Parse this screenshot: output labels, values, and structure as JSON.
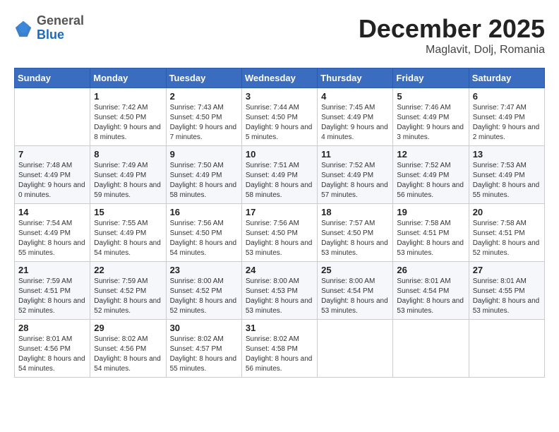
{
  "logo": {
    "general": "General",
    "blue": "Blue"
  },
  "header": {
    "month": "December 2025",
    "location": "Maglavit, Dolj, Romania"
  },
  "weekdays": [
    "Sunday",
    "Monday",
    "Tuesday",
    "Wednesday",
    "Thursday",
    "Friday",
    "Saturday"
  ],
  "weeks": [
    [
      {
        "day": "",
        "sunrise": "",
        "sunset": "",
        "daylight": ""
      },
      {
        "day": "1",
        "sunrise": "Sunrise: 7:42 AM",
        "sunset": "Sunset: 4:50 PM",
        "daylight": "Daylight: 9 hours and 8 minutes."
      },
      {
        "day": "2",
        "sunrise": "Sunrise: 7:43 AM",
        "sunset": "Sunset: 4:50 PM",
        "daylight": "Daylight: 9 hours and 7 minutes."
      },
      {
        "day": "3",
        "sunrise": "Sunrise: 7:44 AM",
        "sunset": "Sunset: 4:50 PM",
        "daylight": "Daylight: 9 hours and 5 minutes."
      },
      {
        "day": "4",
        "sunrise": "Sunrise: 7:45 AM",
        "sunset": "Sunset: 4:49 PM",
        "daylight": "Daylight: 9 hours and 4 minutes."
      },
      {
        "day": "5",
        "sunrise": "Sunrise: 7:46 AM",
        "sunset": "Sunset: 4:49 PM",
        "daylight": "Daylight: 9 hours and 3 minutes."
      },
      {
        "day": "6",
        "sunrise": "Sunrise: 7:47 AM",
        "sunset": "Sunset: 4:49 PM",
        "daylight": "Daylight: 9 hours and 2 minutes."
      }
    ],
    [
      {
        "day": "7",
        "sunrise": "Sunrise: 7:48 AM",
        "sunset": "Sunset: 4:49 PM",
        "daylight": "Daylight: 9 hours and 0 minutes."
      },
      {
        "day": "8",
        "sunrise": "Sunrise: 7:49 AM",
        "sunset": "Sunset: 4:49 PM",
        "daylight": "Daylight: 8 hours and 59 minutes."
      },
      {
        "day": "9",
        "sunrise": "Sunrise: 7:50 AM",
        "sunset": "Sunset: 4:49 PM",
        "daylight": "Daylight: 8 hours and 58 minutes."
      },
      {
        "day": "10",
        "sunrise": "Sunrise: 7:51 AM",
        "sunset": "Sunset: 4:49 PM",
        "daylight": "Daylight: 8 hours and 58 minutes."
      },
      {
        "day": "11",
        "sunrise": "Sunrise: 7:52 AM",
        "sunset": "Sunset: 4:49 PM",
        "daylight": "Daylight: 8 hours and 57 minutes."
      },
      {
        "day": "12",
        "sunrise": "Sunrise: 7:52 AM",
        "sunset": "Sunset: 4:49 PM",
        "daylight": "Daylight: 8 hours and 56 minutes."
      },
      {
        "day": "13",
        "sunrise": "Sunrise: 7:53 AM",
        "sunset": "Sunset: 4:49 PM",
        "daylight": "Daylight: 8 hours and 55 minutes."
      }
    ],
    [
      {
        "day": "14",
        "sunrise": "Sunrise: 7:54 AM",
        "sunset": "Sunset: 4:49 PM",
        "daylight": "Daylight: 8 hours and 55 minutes."
      },
      {
        "day": "15",
        "sunrise": "Sunrise: 7:55 AM",
        "sunset": "Sunset: 4:49 PM",
        "daylight": "Daylight: 8 hours and 54 minutes."
      },
      {
        "day": "16",
        "sunrise": "Sunrise: 7:56 AM",
        "sunset": "Sunset: 4:50 PM",
        "daylight": "Daylight: 8 hours and 54 minutes."
      },
      {
        "day": "17",
        "sunrise": "Sunrise: 7:56 AM",
        "sunset": "Sunset: 4:50 PM",
        "daylight": "Daylight: 8 hours and 53 minutes."
      },
      {
        "day": "18",
        "sunrise": "Sunrise: 7:57 AM",
        "sunset": "Sunset: 4:50 PM",
        "daylight": "Daylight: 8 hours and 53 minutes."
      },
      {
        "day": "19",
        "sunrise": "Sunrise: 7:58 AM",
        "sunset": "Sunset: 4:51 PM",
        "daylight": "Daylight: 8 hours and 53 minutes."
      },
      {
        "day": "20",
        "sunrise": "Sunrise: 7:58 AM",
        "sunset": "Sunset: 4:51 PM",
        "daylight": "Daylight: 8 hours and 52 minutes."
      }
    ],
    [
      {
        "day": "21",
        "sunrise": "Sunrise: 7:59 AM",
        "sunset": "Sunset: 4:51 PM",
        "daylight": "Daylight: 8 hours and 52 minutes."
      },
      {
        "day": "22",
        "sunrise": "Sunrise: 7:59 AM",
        "sunset": "Sunset: 4:52 PM",
        "daylight": "Daylight: 8 hours and 52 minutes."
      },
      {
        "day": "23",
        "sunrise": "Sunrise: 8:00 AM",
        "sunset": "Sunset: 4:52 PM",
        "daylight": "Daylight: 8 hours and 52 minutes."
      },
      {
        "day": "24",
        "sunrise": "Sunrise: 8:00 AM",
        "sunset": "Sunset: 4:53 PM",
        "daylight": "Daylight: 8 hours and 53 minutes."
      },
      {
        "day": "25",
        "sunrise": "Sunrise: 8:00 AM",
        "sunset": "Sunset: 4:54 PM",
        "daylight": "Daylight: 8 hours and 53 minutes."
      },
      {
        "day": "26",
        "sunrise": "Sunrise: 8:01 AM",
        "sunset": "Sunset: 4:54 PM",
        "daylight": "Daylight: 8 hours and 53 minutes."
      },
      {
        "day": "27",
        "sunrise": "Sunrise: 8:01 AM",
        "sunset": "Sunset: 4:55 PM",
        "daylight": "Daylight: 8 hours and 53 minutes."
      }
    ],
    [
      {
        "day": "28",
        "sunrise": "Sunrise: 8:01 AM",
        "sunset": "Sunset: 4:56 PM",
        "daylight": "Daylight: 8 hours and 54 minutes."
      },
      {
        "day": "29",
        "sunrise": "Sunrise: 8:02 AM",
        "sunset": "Sunset: 4:56 PM",
        "daylight": "Daylight: 8 hours and 54 minutes."
      },
      {
        "day": "30",
        "sunrise": "Sunrise: 8:02 AM",
        "sunset": "Sunset: 4:57 PM",
        "daylight": "Daylight: 8 hours and 55 minutes."
      },
      {
        "day": "31",
        "sunrise": "Sunrise: 8:02 AM",
        "sunset": "Sunset: 4:58 PM",
        "daylight": "Daylight: 8 hours and 56 minutes."
      },
      {
        "day": "",
        "sunrise": "",
        "sunset": "",
        "daylight": ""
      },
      {
        "day": "",
        "sunrise": "",
        "sunset": "",
        "daylight": ""
      },
      {
        "day": "",
        "sunrise": "",
        "sunset": "",
        "daylight": ""
      }
    ]
  ]
}
